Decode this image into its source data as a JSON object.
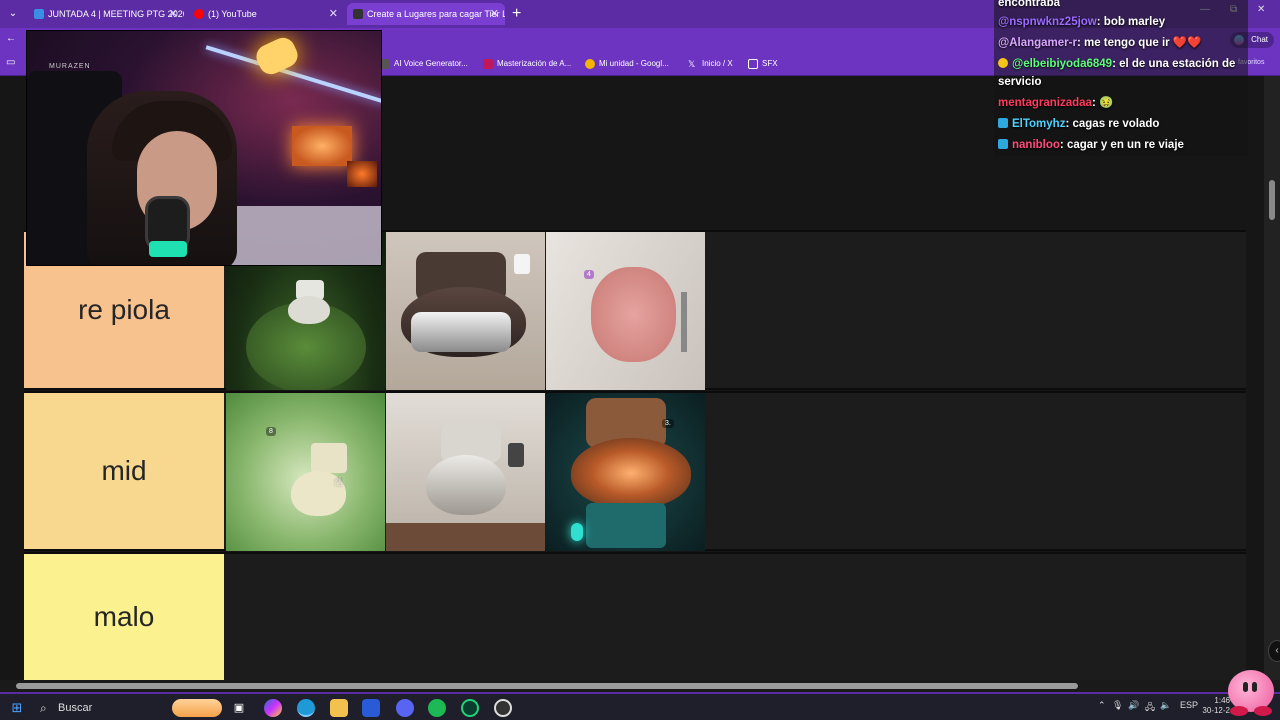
{
  "browser": {
    "tabs": [
      {
        "title": "JUNTADA 4 | MEETING PTG 2026",
        "icon_color": "#3a8ee6"
      },
      {
        "title": "(1) YouTube",
        "icon_color": "#ff0000"
      },
      {
        "title": "Create a Lugares para cagar Tier L",
        "icon_color": "#333333"
      }
    ],
    "new_tab": "+",
    "right_controls": {
      "minimize": "—",
      "restore": "⧉",
      "close": "✕",
      "chat_label": "Chat",
      "favorites_label": "favoritos"
    },
    "bookmarks": [
      {
        "label": "AI Voice Generator...",
        "icon_color": "#555555"
      },
      {
        "label": "Masterización de A...",
        "icon_color": "#c2185b"
      },
      {
        "label": "Mi unidad - Googl...",
        "icon_color": "#f4b400"
      },
      {
        "label": "Inicio / X",
        "icon": "X"
      },
      {
        "label": "SFX",
        "icon": "folder-icon"
      }
    ]
  },
  "webcam": {
    "logo": "MURAZEN"
  },
  "chat": {
    "messages": [
      {
        "user": "",
        "text": "encontraba",
        "user_color": "#ffffff"
      },
      {
        "user": "@nspnwknz25jow",
        "text": ": bob marley",
        "user_color": "#9b6bff"
      },
      {
        "user": "@Alangamer-r",
        "text": ": me tengo que ir ❤️❤️",
        "user_color": "#d8a7ff"
      },
      {
        "user": "@elbeibiyoda6849",
        "text": ": el de una estación de",
        "continuation": "servicio",
        "user_color": "#5cff7a",
        "badge_color": "#f5c518"
      },
      {
        "user": "mentagranizadaa",
        "text": ": 🤢",
        "user_color": "#ff3b5c"
      },
      {
        "user": "ElTomyhz",
        "text": ": cagas re volado",
        "user_color": "#4fd2ff",
        "badge_color": "#2ea9e0"
      },
      {
        "user": "nanibloo",
        "text": ": cagar y en un re viaje",
        "user_color": "#ff4b7a",
        "badge_color": "#2ea9e0"
      }
    ]
  },
  "tiers": [
    {
      "label": "re piola",
      "color": "#f8c28f"
    },
    {
      "label": "mid",
      "color": "#f8d88f"
    },
    {
      "label": "malo",
      "color": "#fbf28f"
    }
  ],
  "taskbar": {
    "search_placeholder": "Buscar",
    "language": "ESP",
    "time": "1:46",
    "date": "30-12-2"
  }
}
